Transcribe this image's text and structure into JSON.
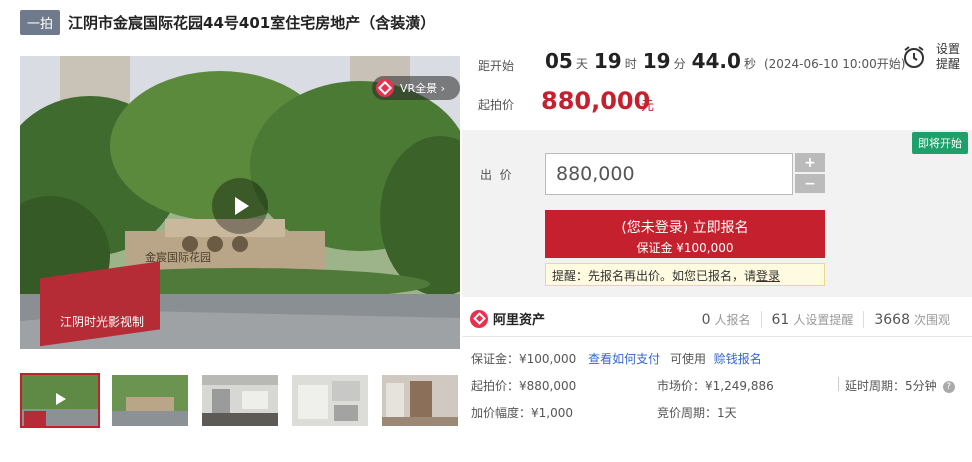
{
  "header": {
    "tag": "一拍",
    "title": "江阴市金宸国际花园44号401室住宅房地产（含装潢）"
  },
  "media": {
    "vr_label": "VR全景 ›",
    "sign_text": "金宸国际花园",
    "banner_text": "江阴时光影视制"
  },
  "countdown": {
    "label": "距开始",
    "days": "05",
    "days_unit": "天",
    "hours": "19",
    "hours_unit": "时",
    "minutes": "19",
    "minutes_unit": "分",
    "seconds": "44.0",
    "seconds_unit": "秒",
    "start_time": "(2024-06-10 10:00开始)"
  },
  "start_price": {
    "label": "起拍价",
    "value": "880,000",
    "unit": "元"
  },
  "remind": {
    "line1": "设置",
    "line2": "提醒"
  },
  "bid": {
    "status_badge": "即将开始",
    "label": "出  价",
    "value": "880,000",
    "plus": "+",
    "minus": "−",
    "signup_line1": "(您未登录) 立即报名",
    "signup_line2": "保证金 ¥100,000",
    "tip_prefix": "提醒：先报名再出价。如您已报名，请",
    "tip_link": "登录"
  },
  "platform": {
    "name": "阿里资产",
    "stats": [
      {
        "n": "0",
        "label": "人报名"
      },
      {
        "n": "61",
        "label": "人设置提醒"
      },
      {
        "n": "3668",
        "label": "次围观"
      }
    ]
  },
  "details": {
    "deposit_label": "保证金：",
    "deposit_value": "¥100,000",
    "how_pay": "查看如何支付",
    "usable": "可使用",
    "credit_signup": "赊钱报名",
    "start_price_label": "起拍价：",
    "start_price_value": "¥880,000",
    "market_label": "市场价：",
    "market_value": "¥1,249,886",
    "delay_label": "延时周期：",
    "delay_value": "5分钟",
    "increment_label": "加价幅度：",
    "increment_value": "¥1,000",
    "cycle_label": "竞价周期：",
    "cycle_value": "1天"
  }
}
